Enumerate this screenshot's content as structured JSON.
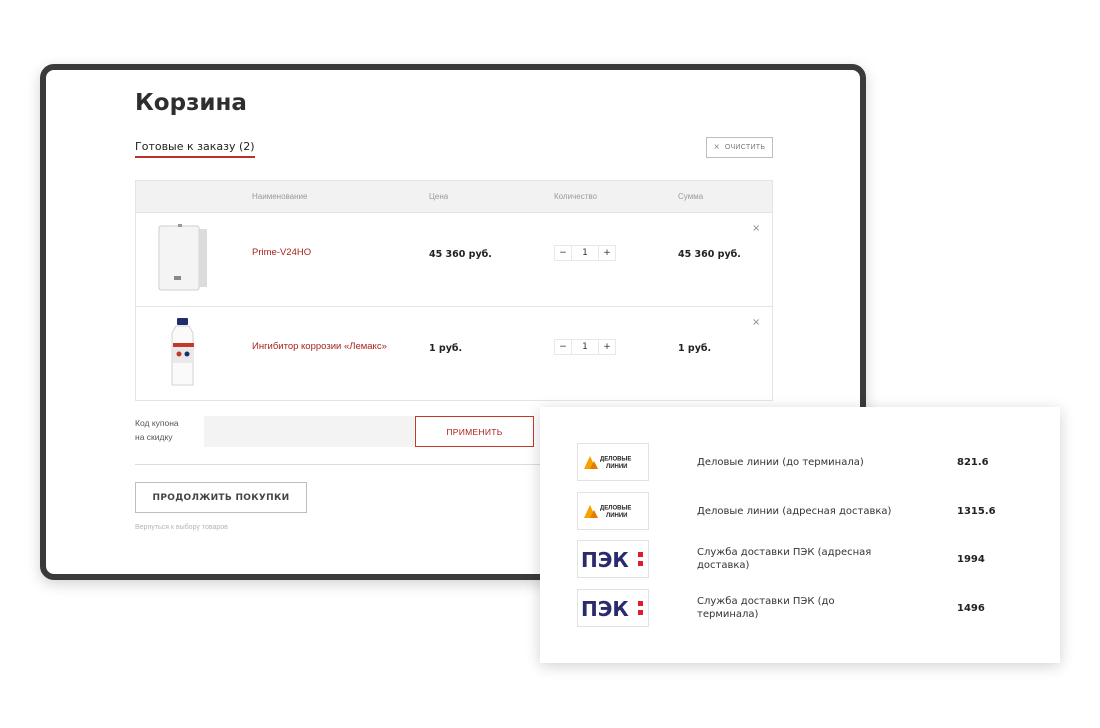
{
  "cart": {
    "title": "Корзина",
    "tab_label": "Готовые к заказу (2)",
    "clear_label": "очистить",
    "columns": {
      "name": "Наименование",
      "price": "Цена",
      "quantity": "Количество",
      "sum": "Сумма"
    },
    "items": [
      {
        "name": "Prime-V24HO",
        "price": "45 360 руб.",
        "quantity": "1",
        "sum": "45 360 руб.",
        "image": "boiler-image"
      },
      {
        "name": "Ингибитор коррозии «Лемакс»",
        "price": "1 руб.",
        "quantity": "1",
        "sum": "1 руб.",
        "image": "bottle-image"
      }
    ],
    "coupon_label_line1": "Код купона",
    "coupon_label_line2": "на скидку",
    "apply_label": "ПРИМЕНИТЬ",
    "continue_label": "ПРОДОЛЖИТЬ ПОКУПКИ",
    "back_link": "Вернуться к выбору товаров",
    "decrement_symbol": "−",
    "increment_symbol": "+",
    "remove_symbol": "×",
    "clear_symbol": "×"
  },
  "delivery": {
    "options": [
      {
        "carrier": "Деловые линии (до терминала)",
        "price": "821.6",
        "logo": "dl-logo",
        "logo_text_1": "ДЕЛОВЫЕ",
        "logo_text_2": "ЛИНИИ"
      },
      {
        "carrier": "Деловые линии (адресная доставка)",
        "price": "1315.6",
        "logo": "dl-logo",
        "logo_text_1": "ДЕЛОВЫЕ",
        "logo_text_2": "ЛИНИИ"
      },
      {
        "carrier": "Служба доставки ПЭК (адресная доставка)",
        "price": "1994",
        "logo": "pek-logo",
        "logo_text_1": "ПЭК"
      },
      {
        "carrier": "Служба доставки ПЭК (до терминала)",
        "price": "1496",
        "logo": "pek-logo",
        "logo_text_1": "ПЭК"
      }
    ]
  },
  "colors": {
    "accent": "#a8231c",
    "frame": "#3a3a3a",
    "pek_blue": "#2a2a6e",
    "pek_red": "#e3192d",
    "dl_orange": "#f5a300"
  }
}
